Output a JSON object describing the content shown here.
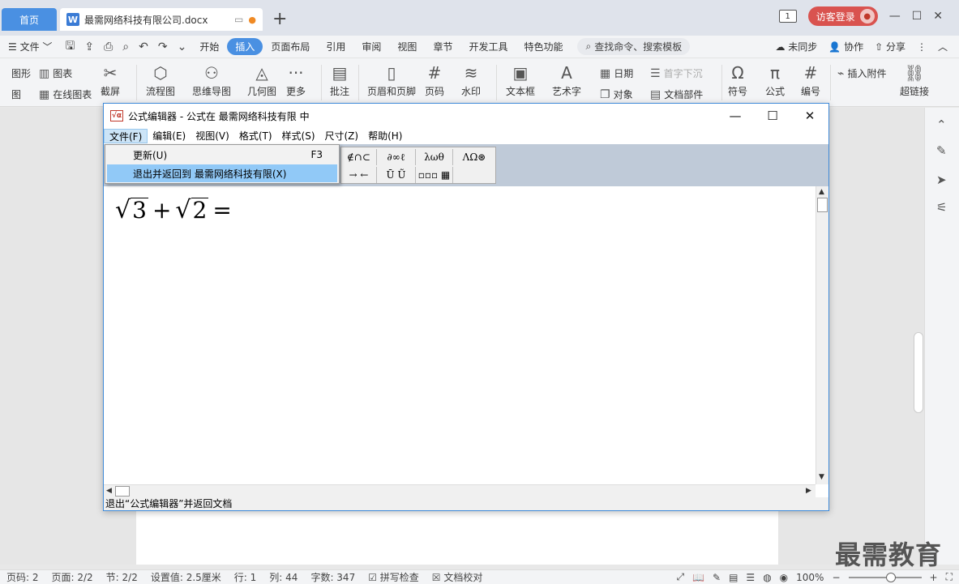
{
  "tabbar": {
    "home_tab": "首页",
    "doc_tab_badge": "W",
    "doc_tab_title": "最需网络科技有限公司.docx",
    "add_tab": "+",
    "page_indicator": "1",
    "login_button": "访客登录"
  },
  "menubar": {
    "file_menu": "文件",
    "items": [
      "开始",
      "插入",
      "页面布局",
      "引用",
      "审阅",
      "视图",
      "章节",
      "开发工具",
      "特色功能"
    ],
    "active_item": "插入",
    "search_placeholder": "查找命令、搜索模板",
    "sync": "未同步",
    "collab": "协作",
    "share": "分享"
  },
  "ribbon": {
    "shape": "图形",
    "image_partial": "图",
    "chart": "图表",
    "online_chart": "在线图表",
    "screenshot": "截屏",
    "flowchart": "流程图",
    "mindmap": "思维导图",
    "geometry": "几何图",
    "more": "更多",
    "comment": "批注",
    "header_footer": "页眉和页脚",
    "page_number": "页码",
    "watermark": "水印",
    "textbox": "文本框",
    "wordart": "艺术字",
    "date": "日期",
    "object": "对象",
    "drop_cap": "首字下沉",
    "doc_parts": "文档部件",
    "symbol": "符号",
    "formula": "公式",
    "numbering": "编号",
    "attachment": "插入附件",
    "hyperlink": "超链接"
  },
  "equation_editor": {
    "title": "公式编辑器 - 公式在 最需网络科技有限 中",
    "menus": [
      "文件(F)",
      "编辑(E)",
      "视图(V)",
      "格式(T)",
      "样式(S)",
      "尺寸(Z)",
      "帮助(H)"
    ],
    "palette_row1": [
      "∉∩⊂",
      "∂∞ℓ",
      "λωθ",
      "ΛΩ⊛"
    ],
    "palette_row2": [
      "→ ←",
      "Ū Ũ",
      "▫▫▫ ▦"
    ],
    "formula": {
      "sqrt1": "3",
      "plus": "+",
      "sqrt2": "2",
      "equals": "="
    },
    "status": "退出“公式编辑器”并返回文档"
  },
  "dropdown": {
    "items": [
      {
        "label": "更新(U)",
        "shortcut": "F3"
      },
      {
        "label": "退出并返回到 最需网络科技有限(X)",
        "shortcut": ""
      }
    ]
  },
  "statusbar": {
    "page_code": "页码: 2",
    "page": "页面: 2/2",
    "section": "节: 2/2",
    "setting": "设置值: 2.5厘米",
    "line": "行: 1",
    "column": "列: 44",
    "word_count": "字数: 347",
    "spell_check": "拼写检查",
    "doc_proof": "文档校对",
    "zoom": "100%",
    "zoom_level": 0.58
  },
  "watermark": "最需教育",
  "colors": {
    "accent": "#4a90e2",
    "login": "#d9534f",
    "menu_highlight": "#91c9f7",
    "eq_toolbar": "#bfcad8"
  }
}
